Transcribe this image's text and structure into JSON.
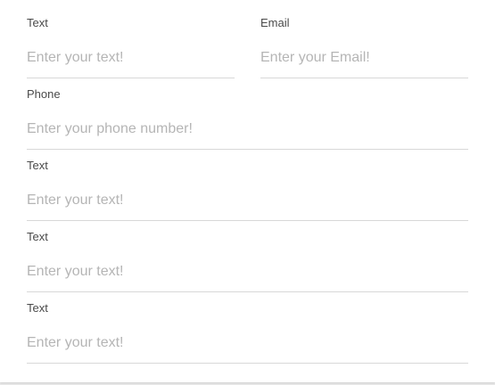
{
  "form": {
    "fields": [
      {
        "label": "Text",
        "value": "",
        "placeholder": "Enter your text!"
      },
      {
        "label": "Email",
        "value": "",
        "placeholder": "Enter your Email!"
      },
      {
        "label": "Phone",
        "value": "",
        "placeholder": "Enter your phone number!"
      },
      {
        "label": "Text",
        "value": "",
        "placeholder": "Enter your text!"
      },
      {
        "label": "Text",
        "value": "",
        "placeholder": "Enter your text!"
      },
      {
        "label": "Text",
        "value": "",
        "placeholder": "Enter your text!"
      }
    ]
  },
  "colors": {
    "label": "#4a4a4a",
    "placeholder": "#b5b5b5",
    "underline": "#d8d8d8",
    "card_background": "#ffffff",
    "page_background": "#e9e9e9"
  }
}
